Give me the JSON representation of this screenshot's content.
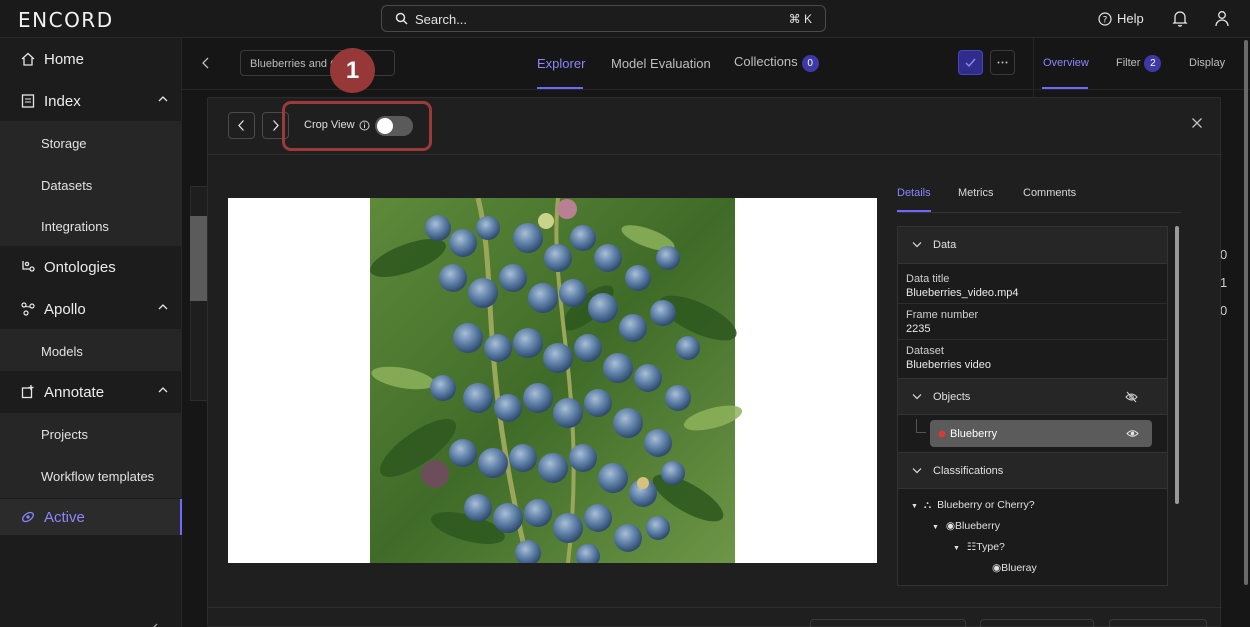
{
  "app": {
    "logo": "ENCORD"
  },
  "topbar": {
    "search_placeholder": "Search...",
    "search_shortcut": "⌘ K",
    "help_label": "Help"
  },
  "sidebar": {
    "home": "Home",
    "index": "Index",
    "index_items": [
      "Storage",
      "Datasets",
      "Integrations"
    ],
    "ontologies": "Ontologies",
    "apollo": "Apollo",
    "apollo_items": [
      "Models"
    ],
    "annotate": "Annotate",
    "annotate_items": [
      "Projects",
      "Workflow templates"
    ],
    "active": "Active"
  },
  "main": {
    "dataset_select": "Blueberries and C",
    "tabs": [
      "Explorer",
      "Model Evaluation",
      "Collections"
    ],
    "collections_count": "0",
    "right_tabs": [
      "Overview",
      "Filter",
      "Display"
    ],
    "filter_count": "2",
    "side_numbers": [
      "0",
      "1",
      "0"
    ]
  },
  "modal": {
    "crop_view_label": "Crop View",
    "crop_view_enabled": false,
    "detail_tabs": [
      "Details",
      "Metrics",
      "Comments"
    ],
    "data_section": "Data",
    "fields": [
      {
        "label": "Data title",
        "value": "Blueberries_video.mp4"
      },
      {
        "label": "Frame number",
        "value": "2235"
      },
      {
        "label": "Dataset",
        "value": "Blueberries video"
      }
    ],
    "objects_section": "Objects",
    "object_item": "Blueberry",
    "classifications_section": "Classifications",
    "tree": [
      "Blueberry or Cherry?",
      "Blueberry",
      "Type?",
      "Blueray"
    ]
  },
  "annotation": {
    "step_number": "1"
  },
  "colors": {
    "accent": "#6f67ff",
    "highlight": "#9c3a3a",
    "object": "#d43c3c"
  }
}
